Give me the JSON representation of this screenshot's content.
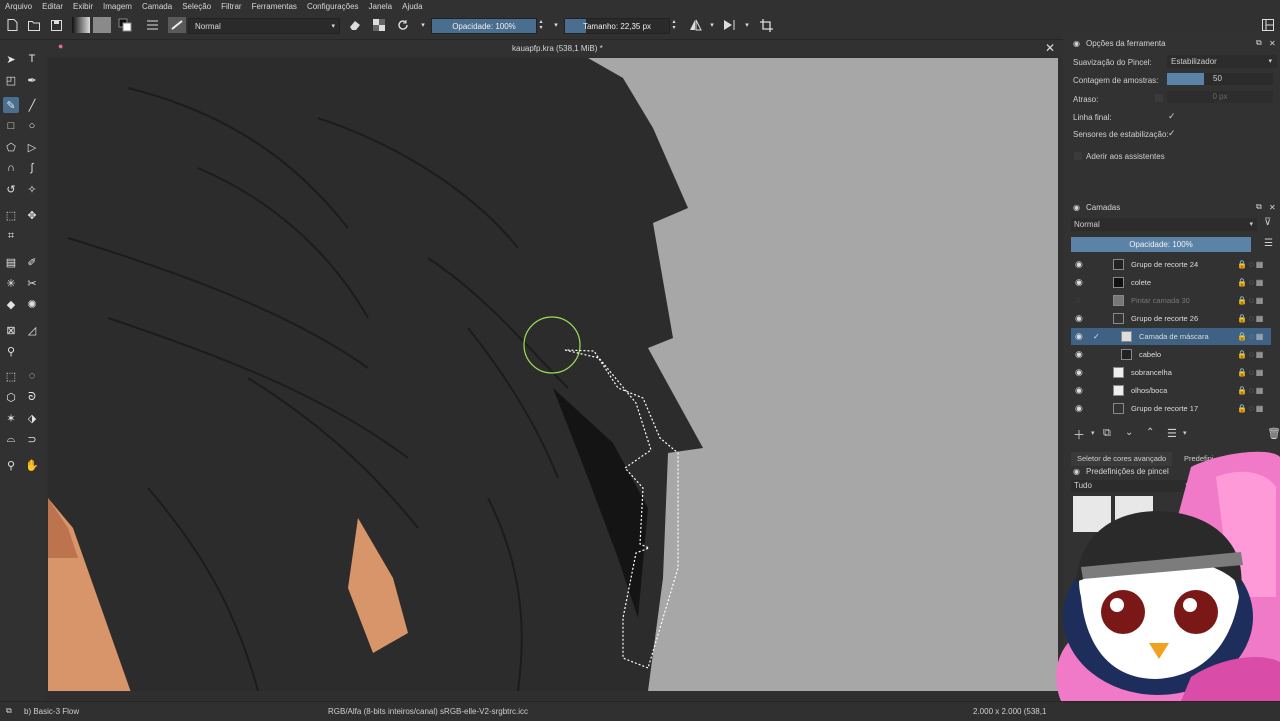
{
  "menu": [
    "Arquivo",
    "Editar",
    "Exibir",
    "Imagem",
    "Camada",
    "Seleção",
    "Filtrar",
    "Ferramentas",
    "Configurações",
    "Janela",
    "Ajuda"
  ],
  "toolbar": {
    "blend_mode": "Normal",
    "opacity": "Opacidade: 100%",
    "size": "Tamanho: 22,35 px",
    "icons": [
      "new-document-icon",
      "open-icon",
      "save-icon",
      "gradient-swatch-icon",
      "pattern-swatch-icon",
      "color-swap-icon",
      "brush-settings-icon",
      "brush-preset-icon",
      "eraser-icon",
      "alpha-lock-icon",
      "reload-icon",
      "mirror-horizontal-icon",
      "mirror-vertical-icon",
      "wrap-around-icon"
    ]
  },
  "document": {
    "title": "kauapfp.kra (538,1 MiB) *"
  },
  "tool_options": {
    "title": "Opções da ferramenta",
    "smoothing_label": "Suavização do Pincel:",
    "smoothing_value": "Estabilizador",
    "sample_count_label": "Contagem de amostras:",
    "sample_count_value": "50",
    "delay_label": "Atraso:",
    "delay_value": "0 px",
    "finish_line_label": "Linha final:",
    "stabilize_sensors_label": "Sensores de estabilização:",
    "snap_assistants_label": "Aderir aos assistentes"
  },
  "layers": {
    "title": "Camadas",
    "blend_mode": "Normal",
    "opacity": "Opacidade:  100%",
    "items": [
      {
        "name": "Grupo de recorte 24",
        "selected": false,
        "dim": false
      },
      {
        "name": "colete",
        "selected": false,
        "dim": false
      },
      {
        "name": "Pintar camada 30",
        "selected": false,
        "dim": true
      },
      {
        "name": "Grupo de recorte 26",
        "selected": false,
        "dim": false
      },
      {
        "name": "Camada de máscara",
        "selected": true,
        "dim": false
      },
      {
        "name": "cabelo",
        "selected": false,
        "dim": false
      },
      {
        "name": "sobrancelha",
        "selected": false,
        "dim": false
      },
      {
        "name": "olhos/boca",
        "selected": false,
        "dim": false
      },
      {
        "name": "Grupo de recorte 17",
        "selected": false,
        "dim": false
      }
    ]
  },
  "bottom_tabs": [
    "Seletor de cores avançado",
    "Predefini"
  ],
  "brush_presets": {
    "title": "Predefinições de pincel",
    "filter": "Tudo"
  },
  "status": {
    "brush": "b) Basic-3 Flow",
    "color_profile": "RGB/Alfa (8-bits inteiros/canal)  sRGB-elle-V2-srgbtrc.icc",
    "dimensions": "2.000 x 2.000 (538,1"
  },
  "colors": {
    "accent": "#4a6e8f",
    "canvas_bg": "#a7a7a7",
    "hair": "#2b2b2b",
    "skin": "#d9956a",
    "brush_cursor": "#9be05a"
  }
}
